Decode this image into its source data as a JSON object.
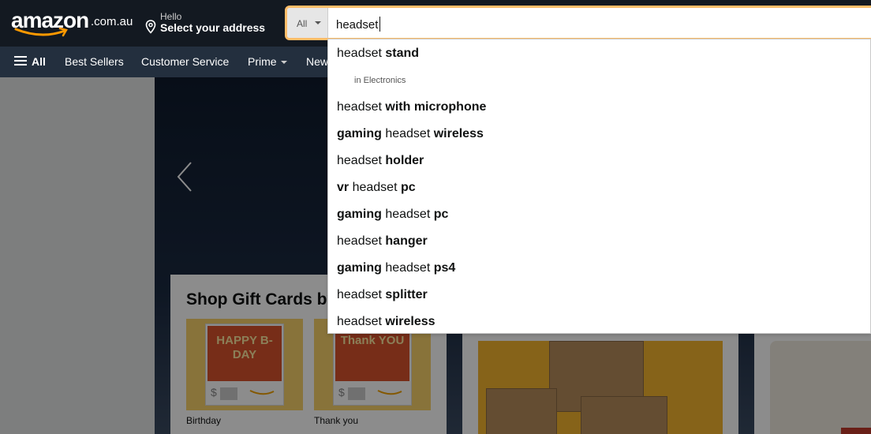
{
  "header": {
    "logo_text": "amazon",
    "logo_suffix": ".com.au",
    "address_hello": "Hello",
    "address_main": "Select your address",
    "search": {
      "category": "All",
      "value": "headset"
    }
  },
  "subnav": {
    "all_label": "All",
    "items": [
      "Best Sellers",
      "Customer Service",
      "Prime",
      "New"
    ]
  },
  "suggestions": [
    {
      "pre": "headset ",
      "bold": "stand",
      "post": "",
      "dept": "in Electronics"
    },
    {
      "pre": "headset ",
      "bold": "with microphone",
      "post": ""
    },
    {
      "bold_pre": "gaming",
      "pre": " headset ",
      "bold": "wireless"
    },
    {
      "pre": "headset ",
      "bold": "holder"
    },
    {
      "bold_pre": "vr",
      "pre": " headset ",
      "bold": "pc"
    },
    {
      "bold_pre": "gaming",
      "pre": " headset ",
      "bold": "pc"
    },
    {
      "pre": "headset ",
      "bold": "hanger"
    },
    {
      "bold_pre": "gaming",
      "pre": " headset ",
      "bold": "ps4"
    },
    {
      "pre": "headset ",
      "bold": "splitter"
    },
    {
      "pre": "headset ",
      "bold": "wireless"
    }
  ],
  "cards": {
    "gift_title": "Shop Gift Cards by",
    "gift_items": [
      {
        "art": "HAPPY B-DAY",
        "label": "Birthday",
        "currency": "$"
      },
      {
        "art": "Thank YOU",
        "label": "Thank you",
        "currency": "$"
      }
    ]
  },
  "colors": {
    "nav_bg": "#131921",
    "subnav_bg": "#232f3e",
    "search_border": "#febd69",
    "brand_orange": "#ff9900"
  }
}
